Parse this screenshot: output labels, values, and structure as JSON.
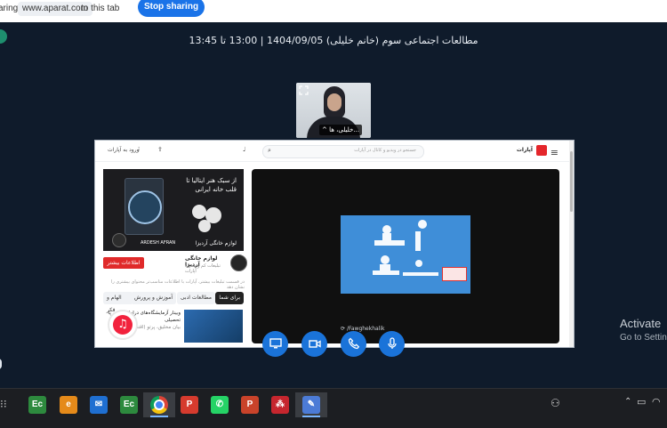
{
  "share_bar": {
    "prefix": "aring",
    "url": "www.aparat.com",
    "suffix": "to this tab",
    "stop_label": "Stop sharing"
  },
  "meeting": {
    "title": "مطالعات اجتماعی سوم (خانم خلیلی) 1404/09/05 | 13:00 تا 13:45",
    "participant_name": "^ خلیلی، ها..."
  },
  "shared_screen": {
    "site_name": "آپارات",
    "search_placeholder": "جستجو در ویدیو و کانال در آپارات",
    "login_label": "ورود به آپارات",
    "channel_watermark": "/Fawghekhalik",
    "ad": {
      "headline": "از سبک هنر ایتالیا تا قلب خانه ایرانی",
      "brand_text": "لوازم خانگی آردیزا",
      "brand_logo": "ARDESH AFRAN"
    },
    "advertiser": {
      "name": "لوازم خانگی آردیزا",
      "sub": "تبلیغات کم و همراه آپارات"
    },
    "more_button": "اطلاعات بیشتر",
    "note": "در قسمت تبلیغات بیشتر، آپارات با اطلاعات مناسب‌تر محتوای بیشتری را نشان دهد",
    "tabs": [
      "برای شما",
      "مطالعات ادبی",
      "آموزش و پرورش",
      "الهام و فکر"
    ],
    "video_title": "وبینار آزمایشگاه‌های دراماتیزه فی پا تحصیلی",
    "video_channel": "بیان مخلیق، پرتو (اقتصادی)"
  },
  "watermark": {
    "line1": "Activate",
    "line2": "Go to Settings"
  },
  "controls": [
    {
      "name": "share-screen-button",
      "icon": "monitor-icon"
    },
    {
      "name": "camera-button",
      "icon": "video-camera-icon"
    },
    {
      "name": "phone-button",
      "icon": "phone-icon"
    },
    {
      "name": "microphone-button",
      "icon": "microphone-icon"
    }
  ],
  "taskbar": {
    "apps": [
      {
        "name": "excel-app",
        "icon": "excel-icon",
        "glyph": "Ec",
        "color": "#2d8a3e"
      },
      {
        "name": "app-orange",
        "icon": "orange-e-icon",
        "glyph": "e",
        "color": "#e58a1a"
      },
      {
        "name": "mail-app",
        "icon": "mail-icon",
        "glyph": "✉",
        "color": "#1f6fd1"
      },
      {
        "name": "excel-app-2",
        "icon": "excel-icon",
        "glyph": "Ec",
        "color": "#2d8a3e"
      },
      {
        "name": "chrome-app",
        "icon": "chrome-icon",
        "glyph": "",
        "color": "#ffffff"
      },
      {
        "name": "pdf-app",
        "icon": "p-icon",
        "glyph": "P",
        "color": "#d63b2e"
      },
      {
        "name": "whatsapp-app",
        "icon": "whatsapp-icon",
        "glyph": "✆",
        "color": "#25d366"
      },
      {
        "name": "powerpoint-app",
        "icon": "powerpoint-icon",
        "glyph": "P",
        "color": "#c9432a"
      },
      {
        "name": "app-red-grid",
        "icon": "grid-icon",
        "glyph": "⁂",
        "color": "#c6262e"
      },
      {
        "name": "paint-app",
        "icon": "paint-icon",
        "glyph": "✎",
        "color": "#4c7bd6"
      }
    ]
  },
  "colors": {
    "background": "#0f1b2b",
    "accent": "#1a73d9"
  }
}
